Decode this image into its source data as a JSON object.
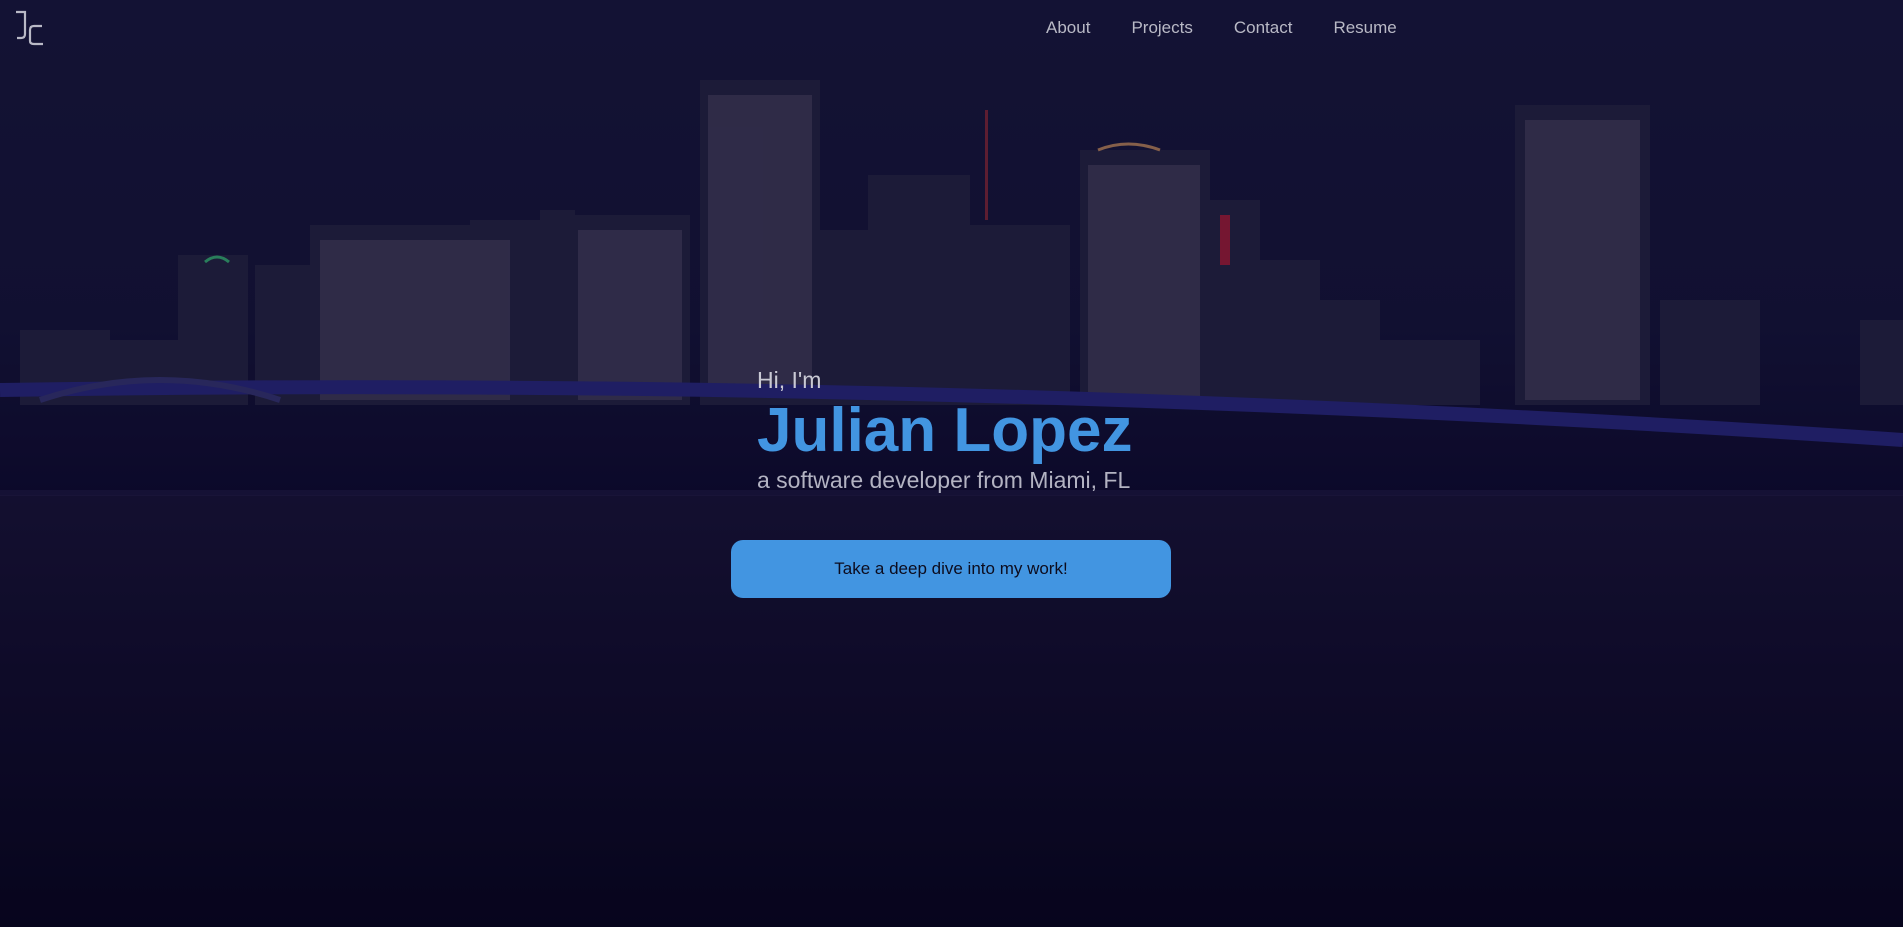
{
  "brand": {
    "logo_icon": "jl-monogram-icon"
  },
  "nav": {
    "items": [
      {
        "label": "About"
      },
      {
        "label": "Projects"
      },
      {
        "label": "Contact"
      },
      {
        "label": "Resume"
      }
    ]
  },
  "hero": {
    "greeting": "Hi, I'm",
    "name": "Julian Lopez",
    "tagline": "a software developer from Miami, FL",
    "cta_label": "Take a deep dive into my work!"
  },
  "colors": {
    "accent": "#4295e1",
    "background": "#0e0b2e",
    "nav_text": "#b9b9c6"
  },
  "background_image": "night-city-skyline-over-water"
}
